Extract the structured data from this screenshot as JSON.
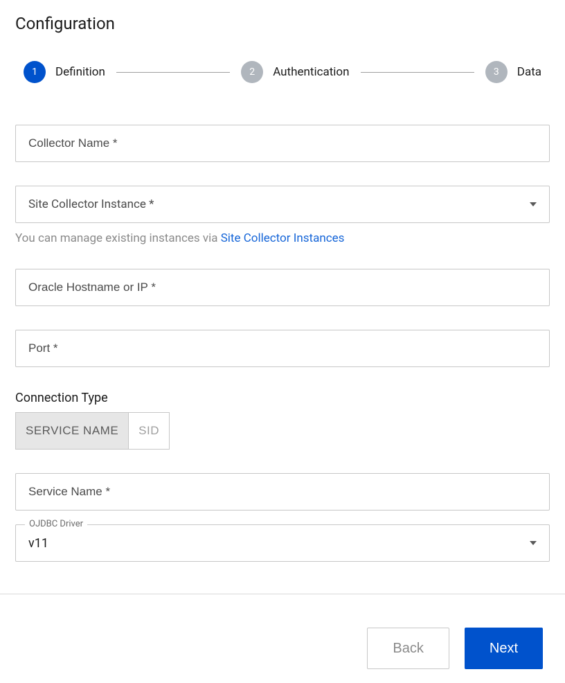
{
  "page_title": "Configuration",
  "stepper": {
    "steps": [
      {
        "num": "1",
        "label": "Definition",
        "active": true
      },
      {
        "num": "2",
        "label": "Authentication",
        "active": false
      },
      {
        "num": "3",
        "label": "Data",
        "active": false
      }
    ]
  },
  "fields": {
    "collector_name": {
      "placeholder": "Collector Name *"
    },
    "site_collector": {
      "placeholder": "Site Collector Instance *"
    },
    "helper_text": "You can manage existing instances via ",
    "helper_link": "Site Collector Instances",
    "oracle_host": {
      "placeholder": "Oracle Hostname or IP *"
    },
    "port": {
      "placeholder": "Port *"
    },
    "connection_type_label": "Connection Type",
    "connection_type_options": {
      "service_name": "SERVICE NAME",
      "sid": "SID"
    },
    "service_name": {
      "placeholder": "Service Name *"
    },
    "ojdbc": {
      "label": "OJDBC Driver",
      "value": "v11"
    }
  },
  "footer": {
    "back": "Back",
    "next": "Next"
  }
}
